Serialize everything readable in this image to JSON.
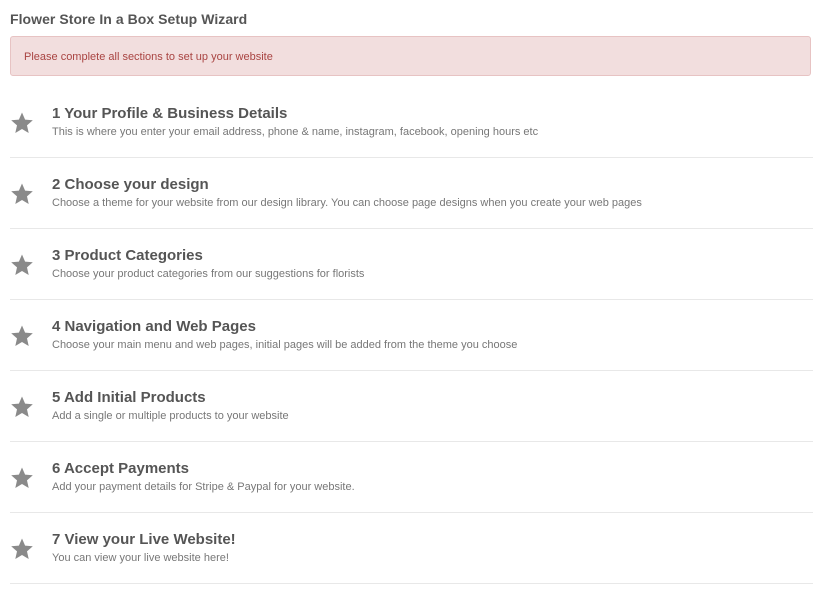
{
  "header": {
    "title": "Flower Store In a Box Setup Wizard"
  },
  "alert": {
    "message": "Please complete all sections to set up your website"
  },
  "icon_color": "#8a8a8a",
  "steps": [
    {
      "icon": "star-icon",
      "title": "1 Your Profile & Business Details",
      "description": "This is where you enter your email address, phone & name, instagram, facebook, opening hours etc"
    },
    {
      "icon": "star-icon",
      "title": "2 Choose your design",
      "description": "Choose a theme for your website from our design library. You can choose page designs when you create your web pages"
    },
    {
      "icon": "star-icon",
      "title": "3 Product Categories",
      "description": "Choose your product categories from our suggestions for florists"
    },
    {
      "icon": "star-icon",
      "title": "4 Navigation and Web Pages",
      "description": "Choose your main menu and web pages, initial pages will be added from the theme you choose"
    },
    {
      "icon": "star-icon",
      "title": "5 Add Initial Products",
      "description": "Add a single or multiple products to your website"
    },
    {
      "icon": "star-icon",
      "title": "6 Accept Payments",
      "description": "Add your payment details for Stripe & Paypal for your website."
    },
    {
      "icon": "star-icon",
      "title": "7 View your Live Website!",
      "description": "You can view your live website here!"
    }
  ]
}
